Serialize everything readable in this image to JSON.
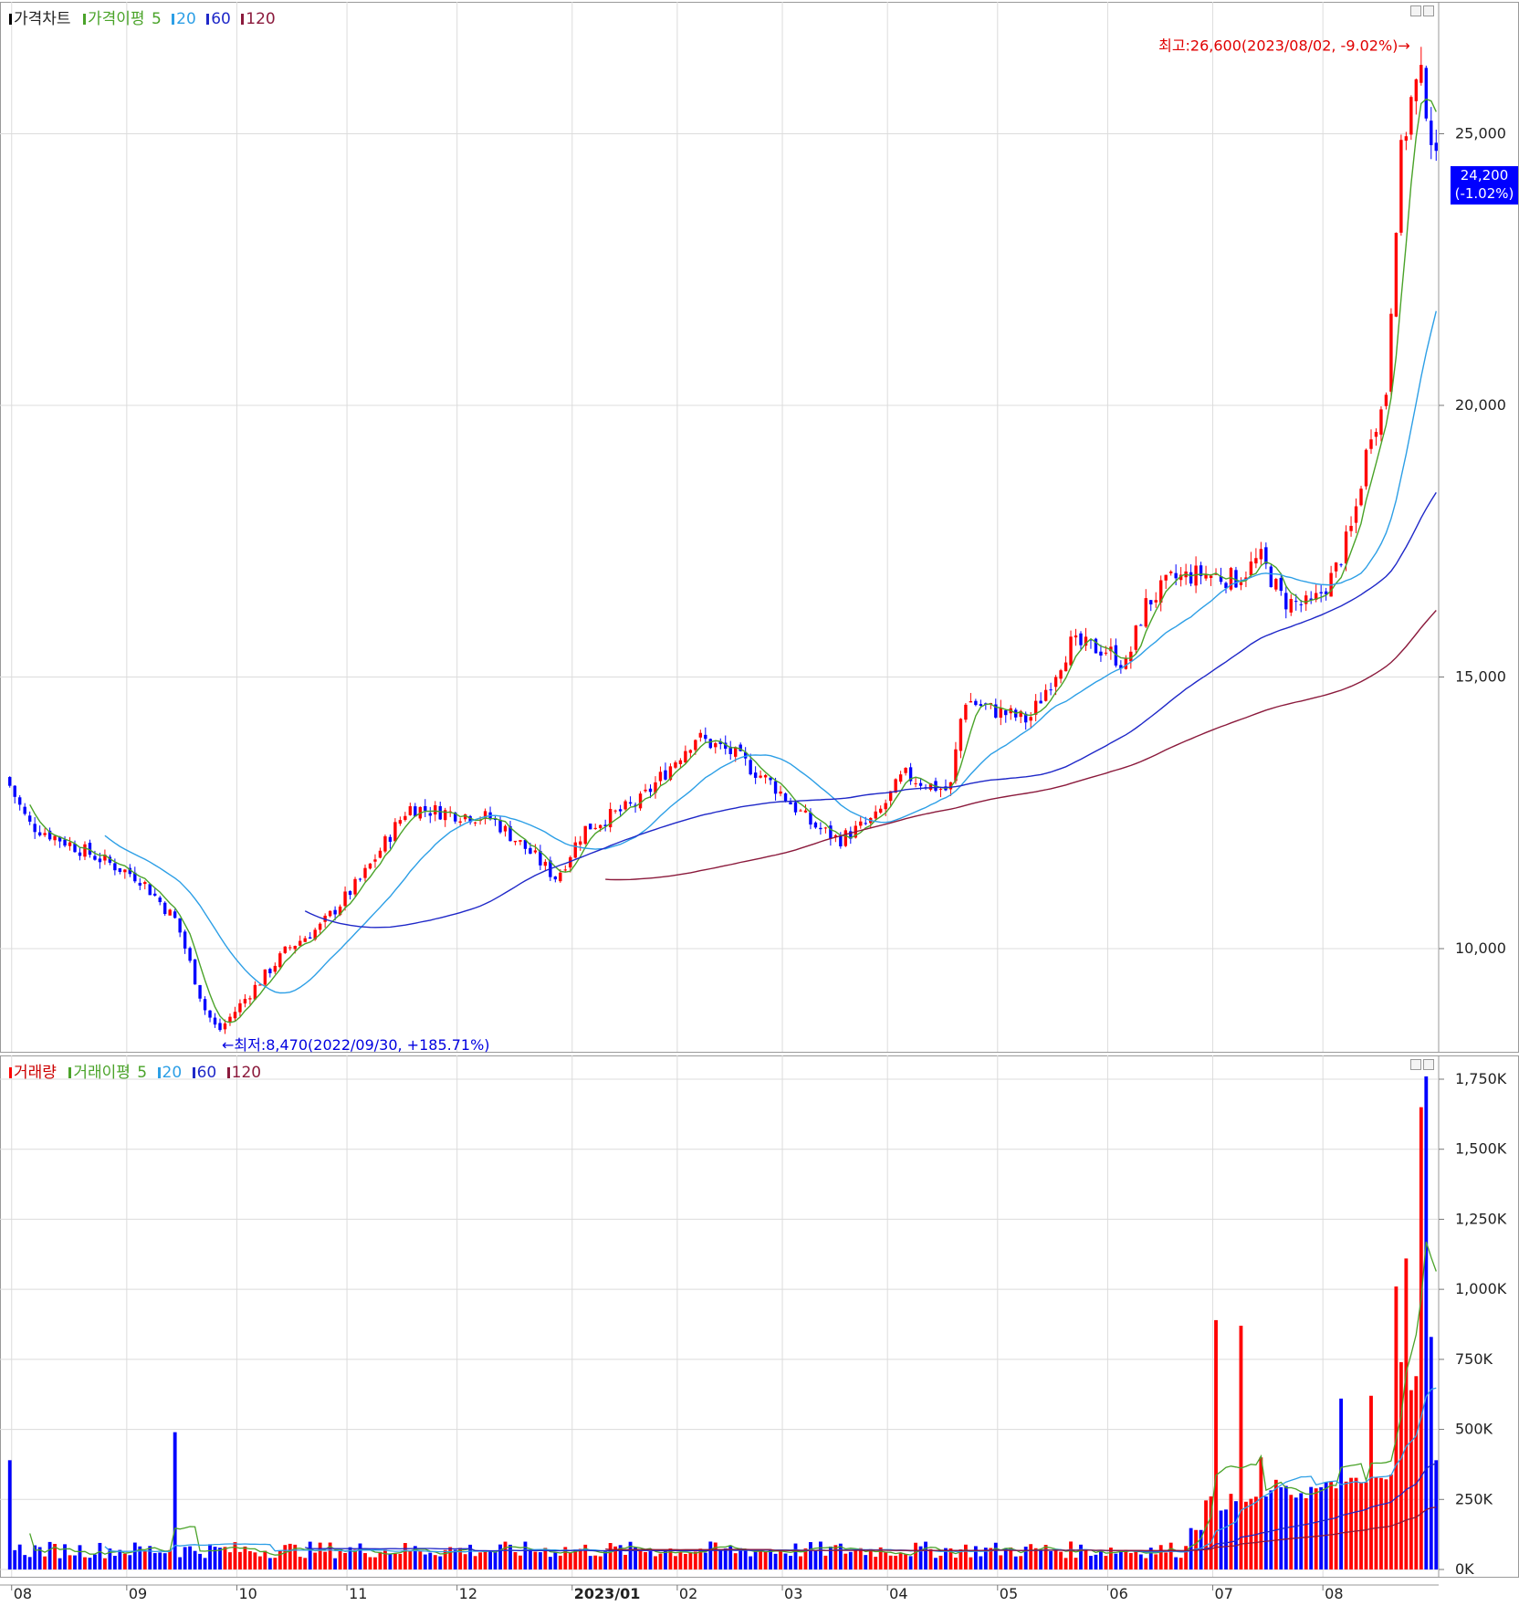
{
  "price_pane": {
    "legend": {
      "chart_label": "가격차트",
      "ma_label": "가격이평",
      "ma5": "5",
      "ma20": "20",
      "ma60": "60",
      "ma120": "120"
    },
    "current_price": "24,200",
    "current_change": "(-1.02%)",
    "high_annotation": "최고:26,600(2023/08/02, -9.02%)",
    "low_annotation": "최저:8,470(2022/09/30, +185.71%)"
  },
  "volume_pane": {
    "legend": {
      "chart_label": "거래량",
      "ma_label": "거래이평",
      "ma5": "5",
      "ma20": "20",
      "ma60": "60",
      "ma120": "120"
    }
  },
  "colors": {
    "up": "#ff0000",
    "down": "#0000ff",
    "ma5": "#4aa329",
    "ma20": "#2d9fe6",
    "ma60": "#1f28c8",
    "ma120": "#8b1a3c",
    "grid": "#dcdcdc"
  },
  "chart_data": [
    {
      "type": "candlestick",
      "y_ticks": [
        "10,000",
        "15,000",
        "20,000",
        "25,000"
      ],
      "ylim": [
        8000,
        27500
      ],
      "x_ticks": [
        "08",
        "09",
        "10",
        "11",
        "12",
        "2023/01",
        "02",
        "03",
        "04",
        "05",
        "06",
        "07",
        "08"
      ],
      "series": [
        {
          "name": "5",
          "x": [
            "08",
            "09",
            "10",
            "11",
            "12",
            "2023/01",
            "02",
            "03",
            "04",
            "05",
            "06",
            "07",
            "08"
          ],
          "values": [
            12200,
            11400,
            8800,
            10500,
            12600,
            12000,
            13400,
            12000,
            13000,
            15800,
            17000,
            16500,
            25400
          ]
        },
        {
          "name": "20",
          "x": [
            "08",
            "09",
            "10",
            "11",
            "12",
            "2023/01",
            "02",
            "03",
            "04",
            "05",
            "06",
            "07",
            "08"
          ],
          "values": [
            12400,
            11600,
            9400,
            9900,
            12000,
            12000,
            12700,
            12500,
            12800,
            14800,
            16200,
            16800,
            21500
          ]
        },
        {
          "name": "60",
          "x": [
            "08",
            "09",
            "10",
            "11",
            "12",
            "2023/01",
            "02",
            "03",
            "04",
            "05",
            "06",
            "07",
            "08"
          ],
          "values": [
            12500,
            12000,
            11300,
            10400,
            10500,
            11400,
            12300,
            12600,
            12800,
            13900,
            15200,
            16500,
            18600
          ]
        },
        {
          "name": "120",
          "x": [
            "08",
            "09",
            "10",
            "11",
            "12",
            "2023/01",
            "02",
            "03",
            "04",
            "05",
            "06",
            "07",
            "08"
          ],
          "values": [
            null,
            null,
            null,
            null,
            11300,
            11300,
            11400,
            11800,
            12200,
            13000,
            13900,
            14600,
            15800
          ]
        }
      ],
      "high": {
        "value": 26600,
        "date": "2023/08/02"
      },
      "low": {
        "value": 8470,
        "date": "2022/09/30"
      }
    },
    {
      "type": "bar",
      "y_ticks": [
        "0K",
        "250K",
        "500K",
        "750K",
        "1,000K",
        "1,250K",
        "1,500K",
        "1,750K"
      ],
      "ylim": [
        0,
        1750000
      ],
      "x_ticks": [
        "08",
        "09",
        "10",
        "11",
        "12",
        "2023/01",
        "02",
        "03",
        "04",
        "05",
        "06",
        "07",
        "08"
      ],
      "spikes": [
        {
          "x": "08",
          "value": 390000
        },
        {
          "x": "10",
          "value": 490000
        },
        {
          "x": "04",
          "value": 890000
        },
        {
          "x": "04",
          "value": 870000
        },
        {
          "x": "05",
          "value": 610000
        },
        {
          "x": "06",
          "value": 620000
        },
        {
          "x": "07",
          "value": 700000
        },
        {
          "x": "07",
          "value": 1110000
        },
        {
          "x": "08",
          "value": 1760000
        }
      ]
    }
  ]
}
